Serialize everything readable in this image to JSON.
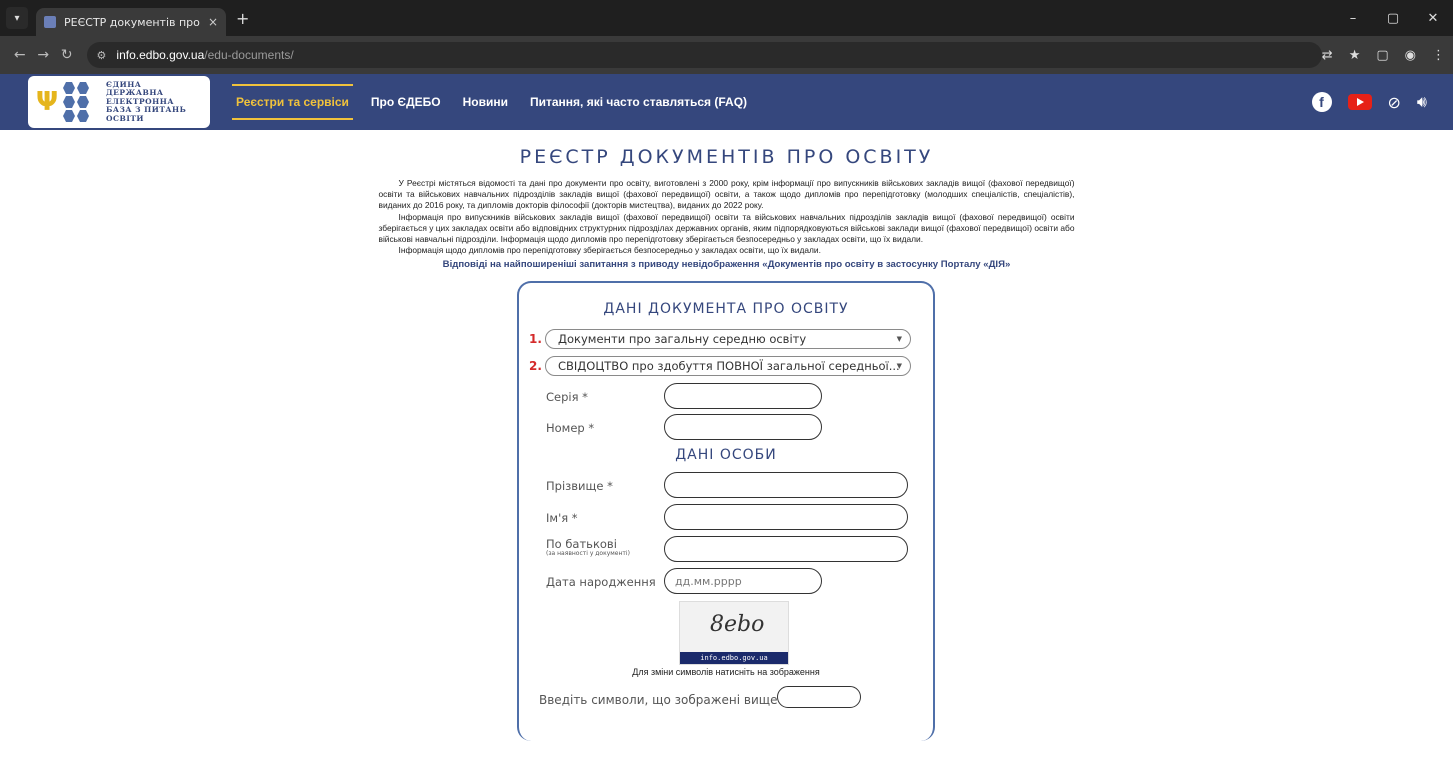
{
  "browser": {
    "tab_title": "РЕЄСТР документів про освіт",
    "tab_close": "×",
    "new_tab": "+",
    "url_host": "info.edbo.gov.ua",
    "url_path": "/edu-documents/",
    "window_controls": [
      "–",
      "▢",
      "✕"
    ]
  },
  "header": {
    "logo_text": "ЄДИНА\nДЕРЖАВНА\nЕЛЕКТРОННА\nБАЗА З ПИТАНЬ\nОСВІТИ",
    "nav": [
      {
        "label": "Реєстри та сервіси",
        "active": true
      },
      {
        "label": "Про ЄДЕБО",
        "active": false
      },
      {
        "label": "Новини",
        "active": false
      },
      {
        "label": "Питання, які часто ставляться (FAQ)",
        "active": false
      }
    ],
    "icons": [
      "facebook-icon",
      "youtube-icon",
      "eye-slash-icon",
      "speaker-icon"
    ]
  },
  "main": {
    "title": "РЕЄСТР ДОКУМЕНТІВ ПРО ОСВІТУ",
    "paragraphs": [
      "У Реєстрі містяться відомості та дані про документи про освіту, виготовлені з 2000 року, крім інформації про випускників військових закладів вищої (фахової передвищої) освіти та військових навчальних підрозділів закладів вищої (фахової передвищої) освіти, а також щодо дипломів про перепідготовку (молодших спеціалістів, спеціалістів), виданих до 2016 року, та дипломів докторів філософії (докторів мистецтва), виданих до 2022 року.",
      "Інформація про випускників військових закладів вищої (фахової передвищої) освіти та військових навчальних підрозділів закладів вищої (фахової передвищої) освіти зберігається у цих закладах освіти або відповідних структурних підрозділах державних органів, яким підпорядковуються військові заклади вищої (фахової передвищої) освіти або військові навчальні підрозділи. Інформація щодо дипломів про перепідготовку зберігається безпосередньо у закладах освіти, що їх видали.",
      "Інформація щодо дипломів про перепідготовку зберігається безпосередньо у закладах освіти, що їх видали."
    ],
    "faq_link": "Відповіді на найпоширеніші запитання з приводу невідображення «Документів про освіту в застосунку Порталу «ДІЯ»"
  },
  "form": {
    "doc_heading": "ДАНІ ДОКУМЕНТА ПРО ОСВІТУ",
    "select1_num": "1.",
    "select1_value": "Документи про загальну середню освіту",
    "select2_num": "2.",
    "select2_value": "СВІДОЦТВО про здобуття ПОВНОЇ загальної середньої...",
    "series_label": "Серія *",
    "number_label": "Номер *",
    "person_heading": "ДАНІ ОСОБИ",
    "surname_label": "Прізвище *",
    "name_label": "Ім'я *",
    "patronymic_label": "По батькові",
    "patronymic_note": "(за наявності у документі)",
    "birthdate_label": "Дата народження",
    "birthdate_placeholder": "дд.мм.рррр",
    "captcha_text": "8ebo",
    "captcha_site": "info.edbo.gov.ua",
    "captcha_hint": "Для зміни символів натисніть на зображення",
    "code_label": "Введіть символи, що зображені вище"
  }
}
